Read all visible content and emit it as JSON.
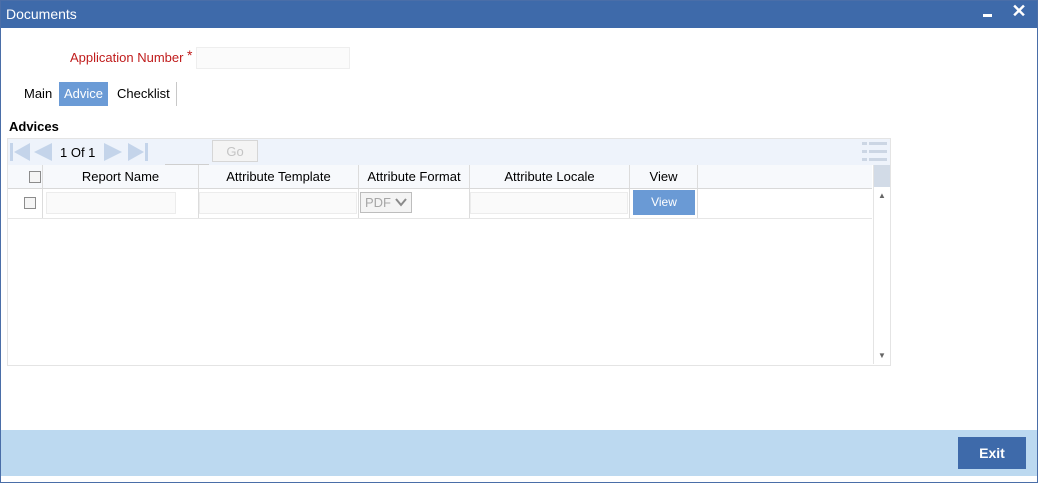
{
  "window": {
    "title": "Documents"
  },
  "form": {
    "application_number_label": "Application Number",
    "required_marker": "*",
    "application_number_value": ""
  },
  "tabs": [
    {
      "label": "Main"
    },
    {
      "label": "Advice"
    },
    {
      "label": "Checklist"
    }
  ],
  "active_tab": "Advice",
  "section": {
    "title": "Advices"
  },
  "grid": {
    "page_info": "1 Of 1",
    "goto_value": "",
    "go_label": "Go",
    "columns": [
      "Report Name",
      "Attribute Template",
      "Attribute Format",
      "Attribute Locale",
      "View"
    ],
    "rows": [
      {
        "report_name": "",
        "attribute_template": "",
        "attribute_format": "PDF",
        "attribute_locale": "",
        "view_label": "View"
      }
    ]
  },
  "footer": {
    "exit_label": "Exit"
  },
  "colors": {
    "title_bar": "#3e6aaa",
    "active_tab": "#6b9bd6",
    "footer": "#bcd9f0",
    "required": "#c01c1c"
  }
}
